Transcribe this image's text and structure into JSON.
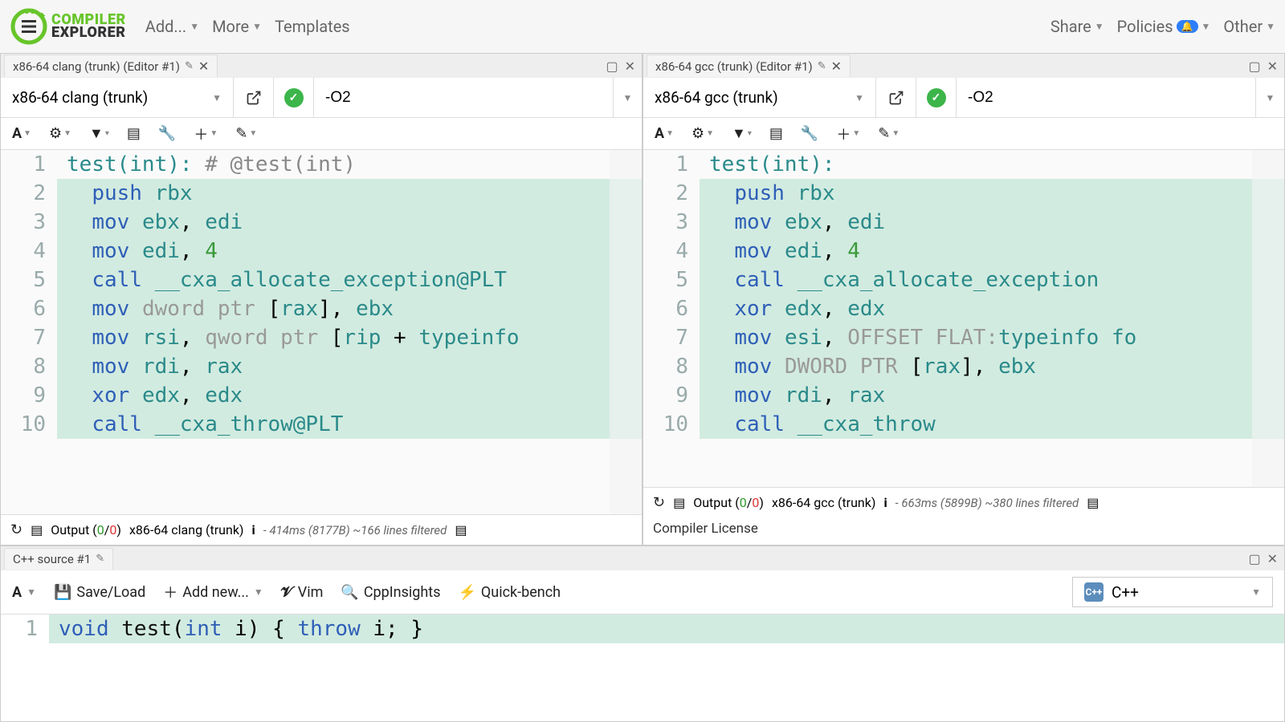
{
  "nav": {
    "brand1": "COMPILER",
    "brand2": "EXPLORER",
    "add": "Add...",
    "more": "More",
    "templates": "Templates",
    "share": "Share",
    "policies": "Policies",
    "other": "Other"
  },
  "left": {
    "tab": "x86-64 clang (trunk) (Editor #1)",
    "compiler": "x86-64 clang (trunk)",
    "flags": "-O2",
    "code": [
      {
        "n": "1",
        "hl": false,
        "html": "<span class='tok-fn'>test(int):</span> <span class='tok-cmt'># @test(int)</span>"
      },
      {
        "n": "2",
        "hl": true,
        "html": "  <span class='tok-kw'>push</span> <span class='tok-reg'>rbx</span>"
      },
      {
        "n": "3",
        "hl": true,
        "html": "  <span class='tok-kw'>mov</span> <span class='tok-reg'>ebx</span>, <span class='tok-reg'>edi</span>"
      },
      {
        "n": "4",
        "hl": true,
        "html": "  <span class='tok-kw'>mov</span> <span class='tok-reg'>edi</span>, <span class='tok-num'>4</span>"
      },
      {
        "n": "5",
        "hl": true,
        "html": "  <span class='tok-kw'>call</span> <span class='tok-sym'>__cxa_allocate_exception@PLT</span>"
      },
      {
        "n": "6",
        "hl": true,
        "html": "  <span class='tok-kw'>mov</span> <span class='tok-dir'>dword ptr</span> [<span class='tok-reg'>rax</span>], <span class='tok-reg'>ebx</span>"
      },
      {
        "n": "7",
        "hl": true,
        "html": "  <span class='tok-kw'>mov</span> <span class='tok-reg'>rsi</span>, <span class='tok-dir'>qword ptr</span> [<span class='tok-reg'>rip</span> + <span class='tok-sym'>typeinfo </span>"
      },
      {
        "n": "8",
        "hl": true,
        "html": "  <span class='tok-kw'>mov</span> <span class='tok-reg'>rdi</span>, <span class='tok-reg'>rax</span>"
      },
      {
        "n": "9",
        "hl": true,
        "html": "  <span class='tok-kw'>xor</span> <span class='tok-reg'>edx</span>, <span class='tok-reg'>edx</span>"
      },
      {
        "n": "10",
        "hl": true,
        "html": "  <span class='tok-kw'>call</span> <span class='tok-sym'>__cxa_throw@PLT</span>"
      }
    ],
    "out_label": "Output",
    "out_ok": "0",
    "out_err": "0",
    "compiler_short": "x86-64 clang (trunk)",
    "timing": "- 414ms (8177B) ~166 lines filtered"
  },
  "right": {
    "tab": "x86-64 gcc (trunk) (Editor #1)",
    "compiler": "x86-64 gcc (trunk)",
    "flags": "-O2",
    "code": [
      {
        "n": "1",
        "hl": false,
        "html": "<span class='tok-fn'>test(int):</span>"
      },
      {
        "n": "2",
        "hl": true,
        "html": "  <span class='tok-kw'>push</span> <span class='tok-reg'>rbx</span>"
      },
      {
        "n": "3",
        "hl": true,
        "html": "  <span class='tok-kw'>mov</span> <span class='tok-reg'>ebx</span>, <span class='tok-reg'>edi</span>"
      },
      {
        "n": "4",
        "hl": true,
        "html": "  <span class='tok-kw'>mov</span> <span class='tok-reg'>edi</span>, <span class='tok-num'>4</span>"
      },
      {
        "n": "5",
        "hl": true,
        "html": "  <span class='tok-kw'>call</span> <span class='tok-sym'>__cxa_allocate_exception</span>"
      },
      {
        "n": "6",
        "hl": true,
        "html": "  <span class='tok-kw'>xor</span> <span class='tok-reg'>edx</span>, <span class='tok-reg'>edx</span>"
      },
      {
        "n": "7",
        "hl": true,
        "html": "  <span class='tok-kw'>mov</span> <span class='tok-reg'>esi</span>, <span class='tok-dir'>OFFSET FLAT:</span><span class='tok-sym'>typeinfo fo</span>"
      },
      {
        "n": "8",
        "hl": true,
        "html": "  <span class='tok-kw'>mov</span> <span class='tok-dir'>DWORD PTR</span> [<span class='tok-reg'>rax</span>], <span class='tok-reg'>ebx</span>"
      },
      {
        "n": "9",
        "hl": true,
        "html": "  <span class='tok-kw'>mov</span> <span class='tok-reg'>rdi</span>, <span class='tok-reg'>rax</span>"
      },
      {
        "n": "10",
        "hl": true,
        "html": "  <span class='tok-kw'>call</span> <span class='tok-sym'>__cxa_throw</span>"
      }
    ],
    "out_label": "Output",
    "out_ok": "0",
    "out_err": "0",
    "compiler_short": "x86-64 gcc (trunk)",
    "timing": "- 663ms (5899B) ~380 lines filtered",
    "license": "Compiler License"
  },
  "source": {
    "tab": "C++ source #1",
    "saveload": "Save/Load",
    "addnew": "Add new...",
    "vim": "Vim",
    "cppinsights": "CppInsights",
    "quickbench": "Quick-bench",
    "lang": "C++",
    "code": [
      {
        "n": "1",
        "html": "<span class='tok-type'>void</span> <span class='tok-id'>test</span>(<span class='tok-type'>int</span> i) { <span class='tok-kw'>throw</span> i; }"
      }
    ]
  }
}
